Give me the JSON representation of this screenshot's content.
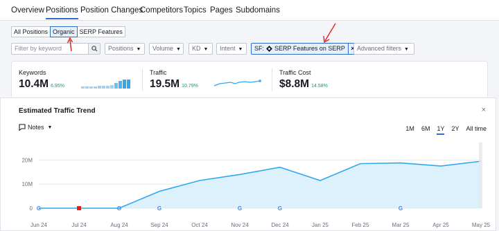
{
  "tabs": [
    "Overview",
    "Positions",
    "Position Changes",
    "Competitors",
    "Topics",
    "Pages",
    "Subdomains"
  ],
  "active_tab": 1,
  "segment": {
    "items": [
      "All Positions",
      "Organic",
      "SERP Features"
    ],
    "active": 1
  },
  "filters": {
    "keyword_placeholder": "Filter by keyword",
    "dropdowns": [
      "Positions",
      "Volume",
      "KD",
      "Intent"
    ],
    "chip_prefix": "SF:",
    "chip_label": "SERP Features on SERP",
    "chip_remove": "×",
    "advanced": "Advanced filters"
  },
  "metrics": [
    {
      "label": "Keywords",
      "value": "10.4M",
      "delta": "6.95%"
    },
    {
      "label": "Traffic",
      "value": "19.5M",
      "delta": "10.79%"
    },
    {
      "label": "Traffic Cost",
      "value": "$8.8M",
      "delta": "14.58%"
    }
  ],
  "trend": {
    "title": "Estimated Traffic Trend",
    "close": "×",
    "notes_label": "Notes",
    "ranges": [
      "1M",
      "6M",
      "1Y",
      "2Y",
      "All time"
    ],
    "active_range": 2
  },
  "colors": {
    "accent": "#2b6ec6",
    "line": "#2fa8ee",
    "area": "#d8effc",
    "positive": "#009f81",
    "annotation_arrow": "#e02020"
  },
  "chart_data": {
    "type": "area",
    "x": [
      "Jun 24",
      "Jul 24",
      "Aug 24",
      "Sep 24",
      "Oct 24",
      "Nov 24",
      "Dec 24",
      "Jan 25",
      "Feb 25",
      "Mar 25",
      "Apr 25",
      "May 25"
    ],
    "y": [
      0,
      0,
      0,
      7,
      11.5,
      14,
      17,
      11.5,
      18.5,
      18.8,
      17.5,
      19.5
    ],
    "ylim": [
      0,
      25
    ],
    "yticks": [
      0,
      10,
      20
    ],
    "ytick_labels": [
      "0",
      "10M",
      "20M"
    ],
    "grid": true,
    "markers": [
      {
        "x": "Jun 24",
        "kind": "google"
      },
      {
        "x": "Jul 24",
        "kind": "note"
      },
      {
        "x": "Aug 24",
        "kind": "google"
      },
      {
        "x": "Sep 24",
        "kind": "google"
      },
      {
        "x": "Nov 24",
        "kind": "google"
      },
      {
        "x": "Dec 24",
        "kind": "google"
      },
      {
        "x": "Mar 25",
        "kind": "google"
      }
    ]
  }
}
